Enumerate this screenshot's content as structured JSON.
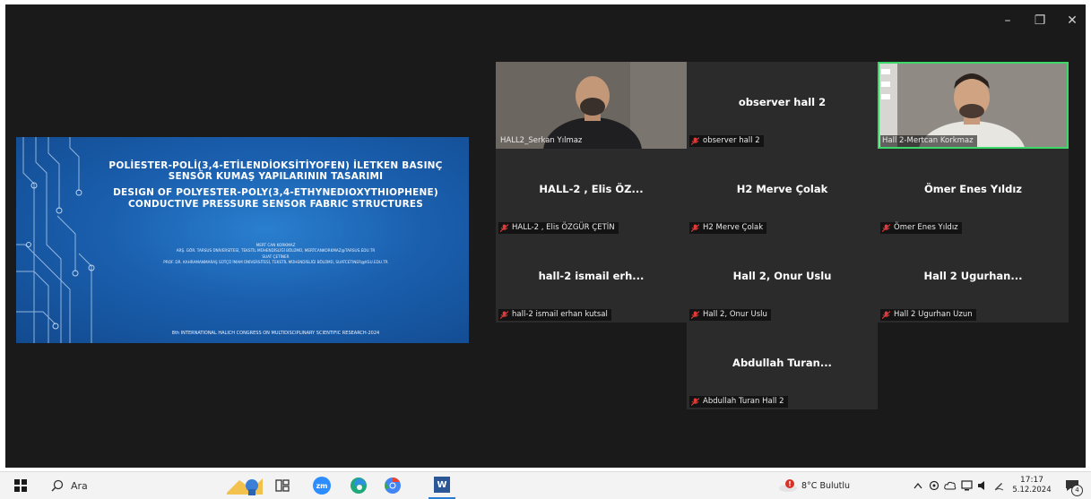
{
  "window": {
    "minimize_glyph": "–",
    "restore_glyph": "❐",
    "close_glyph": "✕"
  },
  "slide": {
    "title_tr": "POLİESTER-POLİ(3,4-ETİLENDİOKSİTİYOFEN) İLETKEN BASINÇ SENSÖR KUMAŞ YAPILARININ TASARIMI",
    "title_en": "DESIGN OF POLYESTER-POLY(3,4-ETHYNEDIOXYTHIOPHENE) CONDUCTIVE PRESSURE SENSOR FABRIC STRUCTURES",
    "author1": "MERT CAN KORKMAZ",
    "author1_affil": "ARŞ. GÖR. TARSUS ÜNİVERSİTESİ, TEKSTİL MÜHENDİSLİĞİ BÖLÜMÜ, MERTCANKORKMAZ@TARSUS.EDU.TR",
    "author2": "SUAT ÇETİNER",
    "author2_affil": "PROF. DR. KAHRAMANMARAŞ SÜTÇÜ İMAM ÜNİVERSİTESİ, TEKSTİL MÜHENDİSLİĞİ BÖLÜMÜ, SUATCETINER@KSU.EDU.TR",
    "footer": "8th INTERNATIONAL HALICH CONGRESS ON MULTIDISCIPLINARY SCIENTIFIC RESEARCH-2024"
  },
  "participants": [
    {
      "center": "",
      "label": "HALL2_Serkan Yılmaz",
      "muted": false,
      "video": true
    },
    {
      "center": "observer hall 2",
      "label": "observer hall 2",
      "muted": true,
      "video": false
    },
    {
      "center": "",
      "label": "Hall 2-Mertcan Korkmaz",
      "muted": false,
      "video": true
    },
    {
      "center": "HALL-2 , Elis ÖZ...",
      "label": "HALL-2 , Elis ÖZGÜR ÇETİN",
      "muted": true,
      "video": false
    },
    {
      "center": "H2 Merve Çolak",
      "label": "H2 Merve Çolak",
      "muted": true,
      "video": false
    },
    {
      "center": "Ömer Enes Yıldız",
      "label": "Ömer Enes Yıldız",
      "muted": true,
      "video": false
    },
    {
      "center": "hall-2 ismail erh...",
      "label": "hall-2 ismail erhan kutsal",
      "muted": true,
      "video": false
    },
    {
      "center": "Hall 2, Onur Uslu",
      "label": "Hall 2, Onur Uslu",
      "muted": true,
      "video": false
    },
    {
      "center": "Hall 2 Ugurhan...",
      "label": "Hall 2 Ugurhan Uzun",
      "muted": true,
      "video": false
    },
    {
      "center": "Abdullah Turan...",
      "label": "Abdullah Turan Hall 2",
      "muted": true,
      "video": false
    }
  ],
  "taskbar": {
    "search_placeholder": "Ara",
    "zoom_label": "zm",
    "word_label": "W",
    "weather": "8°C Bulutlu",
    "time": "17:17",
    "date": "5.12.2024",
    "notifications": "4"
  }
}
